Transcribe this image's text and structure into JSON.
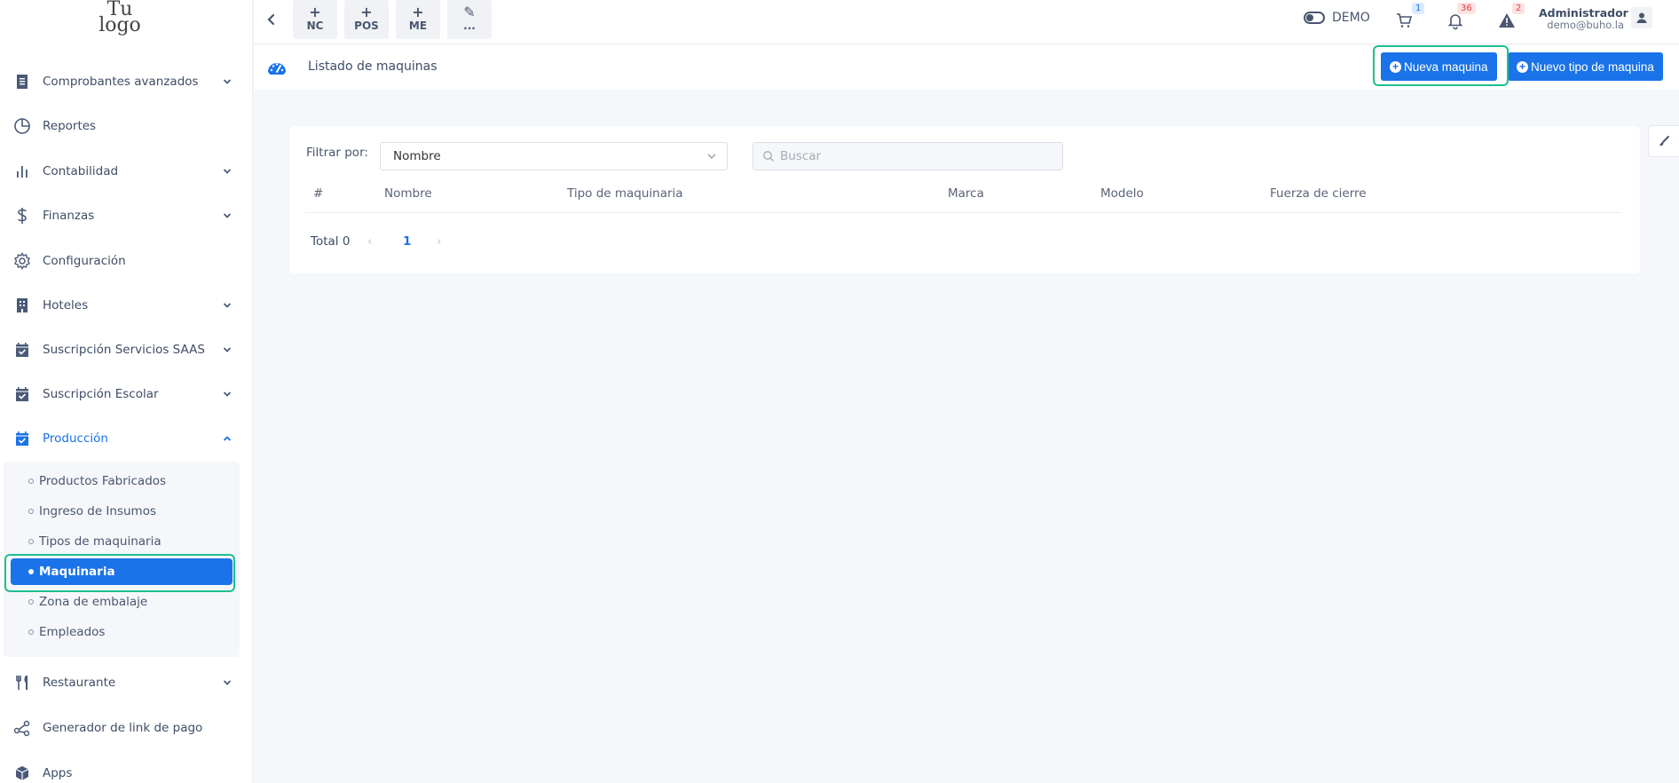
{
  "logo": {
    "line1": "Tu",
    "line2": "logo"
  },
  "sidebar": {
    "items": [
      {
        "label": "Comprobantes avanzados",
        "icon": "receipt-icon",
        "has_children": true
      },
      {
        "label": "Reportes",
        "icon": "pie-chart-icon",
        "has_children": false
      },
      {
        "label": "Contabilidad",
        "icon": "bar-chart-icon",
        "has_children": true
      },
      {
        "label": "Finanzas",
        "icon": "dollar-icon",
        "has_children": true
      },
      {
        "label": "Configuración",
        "icon": "gear-icon",
        "has_children": false
      },
      {
        "label": "Hoteles",
        "icon": "building-icon",
        "has_children": true
      },
      {
        "label": "Suscripción Servicios SAAS",
        "icon": "calendar-check-icon",
        "has_children": true
      },
      {
        "label": "Suscripción Escolar",
        "icon": "calendar-check-icon",
        "has_children": true
      },
      {
        "label": "Producción",
        "icon": "calendar-check-icon",
        "has_children": true,
        "expanded": true
      },
      {
        "label": "Restaurante",
        "icon": "utensils-icon",
        "has_children": true
      },
      {
        "label": "Generador de link de pago",
        "icon": "share-icon",
        "has_children": false
      },
      {
        "label": "Apps",
        "icon": "box-icon",
        "has_children": false
      }
    ],
    "production_submenu": [
      "Productos Fabricados",
      "Ingreso de Insumos",
      "Tipos de maquinaria",
      "Maquinaria",
      "Zona de embalaje",
      "Empleados"
    ]
  },
  "topbar": {
    "quick_actions": [
      {
        "plus": "+",
        "label": "NC"
      },
      {
        "plus": "+",
        "label": "POS"
      },
      {
        "plus": "+",
        "label": "ME"
      },
      {
        "plus": "✎",
        "label": "..."
      }
    ],
    "demo_label": "DEMO",
    "cart_badge": "1",
    "bell_badge": "36",
    "alert_badge": "2",
    "user_name": "Administrador",
    "user_email": "demo@buho.la"
  },
  "page": {
    "title": "Listado de maquinas",
    "new_machine_button": "Nueva maquina",
    "new_type_button": "Nuevo tipo de maquina"
  },
  "filter": {
    "label": "Filtrar por:",
    "selected": "Nombre",
    "search_placeholder": "Buscar"
  },
  "table": {
    "columns": [
      "#",
      "Nombre",
      "Tipo de maquinaria",
      "Marca",
      "Modelo",
      "Fuerza de cierre"
    ],
    "rows": []
  },
  "pagination": {
    "total_label": "Total 0",
    "prev": "‹",
    "current_page": "1",
    "next": "›"
  },
  "colors": {
    "accent": "#1a73e8",
    "highlight": "#1fbf8f"
  }
}
